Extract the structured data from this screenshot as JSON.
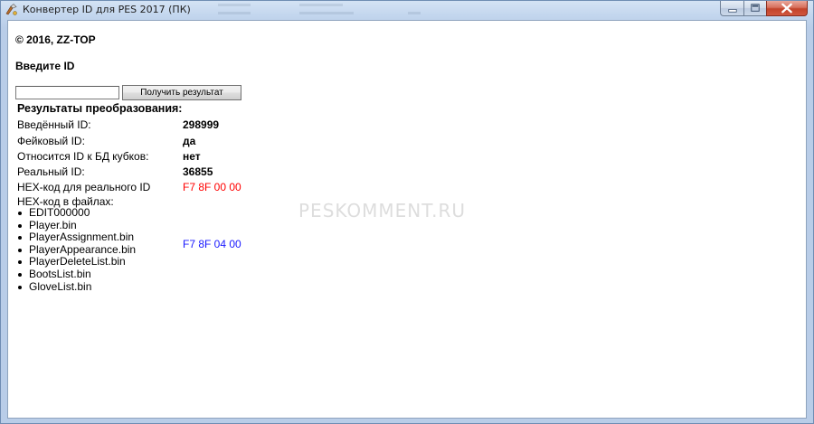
{
  "window": {
    "title": "Конвертер ID для PES 2017 (ПК)",
    "caption_buttons": [
      "minimize",
      "maximize",
      "close"
    ],
    "close_color": "#c7412c"
  },
  "app": {
    "copyright": "© 2016, ZZ-TOP",
    "enter_id_label": "Введите ID",
    "id_input": {
      "value": "",
      "placeholder": ""
    },
    "get_result_button": "Получить результат",
    "results": {
      "heading": "Результаты преобразования:",
      "entered_id_label": "Введённый ID:",
      "entered_id_value": "298999",
      "fake_id_label": "Фейковый ID:",
      "fake_id_value": "да",
      "cup_db_label": "Относится ID к БД кубков:",
      "cup_db_value": "нет",
      "real_id_label": "Реальный ID:",
      "real_id_value": "36855",
      "hex_real_label": "HEX-код для реального ID",
      "hex_real_value": "F7 8F 00 00",
      "hex_real_color": "#ff0000",
      "hex_files_label": "HEX-код в файлах:",
      "hex_files_value": "F7 8F 04 00",
      "hex_files_color": "#1a1aff",
      "files": [
        "EDIT000000",
        "Player.bin",
        "PlayerAssignment.bin",
        "PlayerAppearance.bin",
        "PlayerDeleteList.bin",
        "BootsList.bin",
        "GloveList.bin"
      ]
    }
  },
  "watermark": "PESKOMMENT.RU"
}
